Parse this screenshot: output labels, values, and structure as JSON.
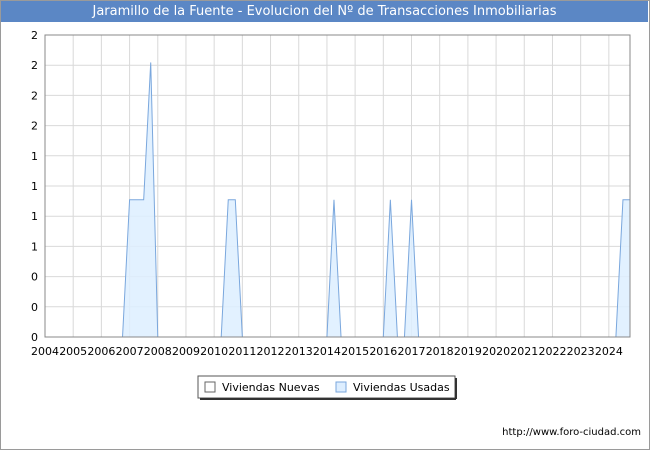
{
  "window": {
    "title": "Jaramillo de la Fuente - Evolucion del Nº de Transacciones Inmobiliarias",
    "footer_url": "http://www.foro-ciudad.com"
  },
  "colors": {
    "title_bar": "#5b87c5",
    "grid": "#d9d9d9",
    "nuevas_fill": "#ffffff",
    "nuevas_stroke": "#666666",
    "usadas_fill": "#ddeeff",
    "usadas_stroke": "#7aa7dd"
  },
  "chart_data": {
    "type": "area",
    "title": "Jaramillo de la Fuente - Evolucion del Nº de Transacciones Inmobiliarias",
    "xlabel": "",
    "ylabel": "",
    "x_ticks": [
      "2004",
      "2005",
      "2006",
      "2007",
      "2008",
      "2009",
      "2010",
      "2011",
      "2012",
      "2013",
      "2014",
      "2015",
      "2016",
      "2017",
      "2018",
      "2019",
      "2020",
      "2021",
      "2022",
      "2023",
      "2024"
    ],
    "y_ticks": [
      "0",
      "0",
      "0",
      "1",
      "1",
      "1",
      "1",
      "2",
      "2",
      "2",
      "2"
    ],
    "y_range": [
      0,
      2.2
    ],
    "x_range": [
      2004.0,
      2024.75
    ],
    "grid": true,
    "legend_position": "bottom-center",
    "series": [
      {
        "name": "Viviendas Nuevas",
        "points": []
      },
      {
        "name": "Viviendas Usadas",
        "points": [
          [
            2006.75,
            0
          ],
          [
            2007.0,
            1
          ],
          [
            2007.25,
            1
          ],
          [
            2007.5,
            1
          ],
          [
            2007.75,
            2
          ],
          [
            2008.0,
            0
          ],
          [
            2008.25,
            0
          ],
          [
            2010.25,
            0
          ],
          [
            2010.5,
            1
          ],
          [
            2010.75,
            1
          ],
          [
            2011.0,
            0
          ],
          [
            2014.0,
            0
          ],
          [
            2014.25,
            1
          ],
          [
            2014.5,
            0
          ],
          [
            2016.0,
            0
          ],
          [
            2016.25,
            1
          ],
          [
            2016.5,
            0
          ],
          [
            2016.75,
            0
          ],
          [
            2017.0,
            1
          ],
          [
            2017.25,
            0
          ],
          [
            2024.25,
            0
          ],
          [
            2024.5,
            1
          ],
          [
            2024.75,
            1
          ]
        ]
      }
    ]
  }
}
